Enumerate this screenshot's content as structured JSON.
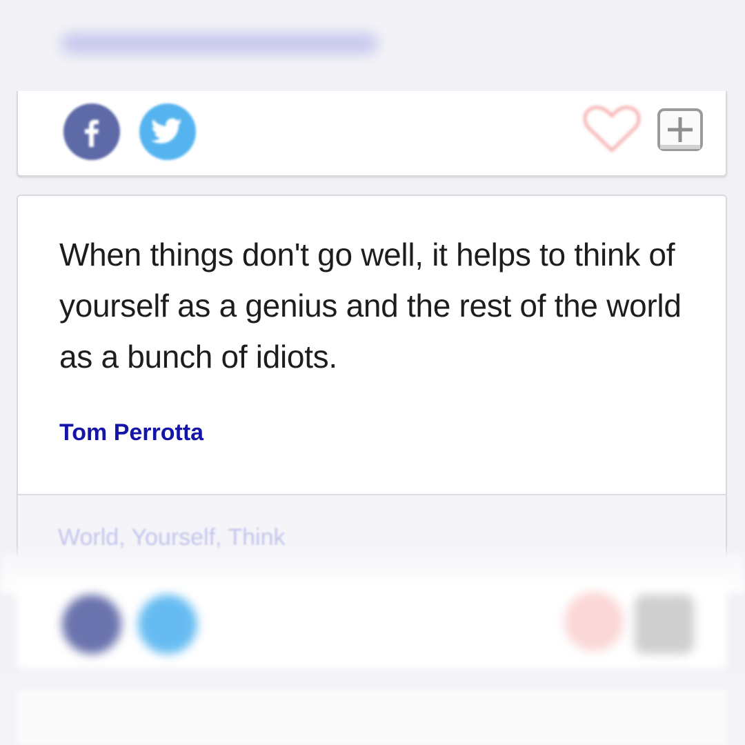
{
  "quote": {
    "text": "When things don't go well, it helps to think of yourself as a genius and the rest of the world as a bunch of idiots.",
    "author": "Tom Perrotta",
    "tags": "World, Yourself, Think"
  },
  "icons": {
    "facebook": "facebook-icon",
    "twitter": "twitter-icon",
    "like": "heart-icon",
    "add": "plus-icon"
  },
  "colors": {
    "author": "#1414a8",
    "facebook": "#5d6aa7",
    "twitter": "#55b4ef",
    "heart": "#f7b7b7",
    "tags": "#c4c4ec"
  }
}
